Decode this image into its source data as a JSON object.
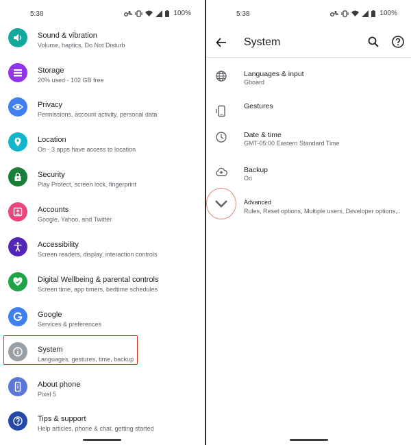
{
  "status_bar": {
    "time": "5:38",
    "battery": "100%"
  },
  "left_screen": {
    "items": [
      {
        "title": "Sound & vibration",
        "subtitle": "Volume, haptics, Do Not Disturb",
        "icon": "volume-icon",
        "color": "#12a89b"
      },
      {
        "title": "Storage",
        "subtitle": "20% used - 102 GB free",
        "icon": "storage-icon",
        "color": "#9334e6"
      },
      {
        "title": "Privacy",
        "subtitle": "Permissions, account activity, personal data",
        "icon": "eye-icon",
        "color": "#3f7ff0"
      },
      {
        "title": "Location",
        "subtitle": "On - 3 apps have access to location",
        "icon": "location-pin-icon",
        "color": "#12b5cb"
      },
      {
        "title": "Security",
        "subtitle": "Play Protect, screen lock, fingerprint",
        "icon": "lock-icon",
        "color": "#188038"
      },
      {
        "title": "Accounts",
        "subtitle": "Google, Yahoo, and Twitter",
        "icon": "account-icon",
        "color": "#e8467c"
      },
      {
        "title": "Accessibility",
        "subtitle": "Screen readers, display, interaction controls",
        "icon": "accessibility-icon",
        "color": "#5324b8"
      },
      {
        "title": "Digital Wellbeing & parental controls",
        "subtitle": "Screen time, app timers, bedtime schedules",
        "icon": "wellbeing-heart-icon",
        "color": "#1ea446"
      },
      {
        "title": "Google",
        "subtitle": "Services & preferences",
        "icon": "google-g-icon",
        "color": "#3f7ff0"
      },
      {
        "title": "System",
        "subtitle": "Languages, gestures, time, backup",
        "icon": "info-icon",
        "color": "#9aa0a6"
      },
      {
        "title": "About phone",
        "subtitle": "Pixel 5",
        "icon": "phone-icon",
        "color": "#5b77d8"
      },
      {
        "title": "Tips & support",
        "subtitle": "Help articles, phone & chat, getting started",
        "icon": "help-icon",
        "color": "#2449a8"
      }
    ]
  },
  "right_screen": {
    "title": "System",
    "items": [
      {
        "title": "Languages & input",
        "subtitle": "Gboard",
        "icon": "globe-icon"
      },
      {
        "title": "Gestures",
        "subtitle": "",
        "icon": "phone-gesture-icon"
      },
      {
        "title": "Date & time",
        "subtitle": "GMT-05:00 Eastern Standard Time",
        "icon": "clock-icon"
      },
      {
        "title": "Backup",
        "subtitle": "On",
        "icon": "cloud-upload-icon"
      },
      {
        "title": "Advanced",
        "subtitle": "Rules, Reset options, Multiple users, Developer options,..",
        "icon": "chevron-down-icon"
      }
    ]
  }
}
